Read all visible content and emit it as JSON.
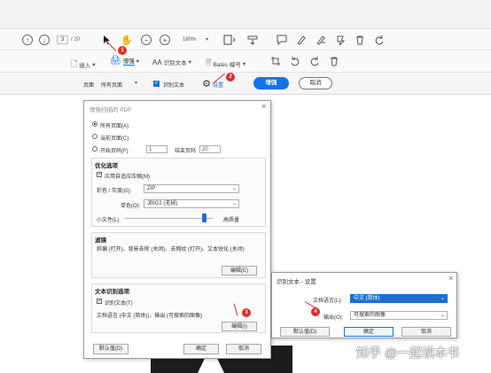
{
  "toolbar1": {
    "page_current": "3",
    "page_total": "/ 20",
    "zoom": "160%"
  },
  "toolbar2": {
    "insert_label": "插入",
    "enhance_label": "增强",
    "ocr_text_label": "识别文本",
    "bates_label": "Bates 编号"
  },
  "toolbar3": {
    "pages_label": "页面",
    "pages_value": "所有页面",
    "ocr_checkbox_label": "识别文本",
    "settings_label": "设置",
    "enhance_button": "增强",
    "cancel_button": "取消"
  },
  "badges": [
    "1",
    "2",
    "3",
    "4"
  ],
  "dialog_main": {
    "title": "增强扫描的 PDF",
    "all_pages": "所有页面(A)",
    "current_page": "当前页面(C)",
    "from_page": "开始页码(F)",
    "from_value": "1",
    "to_label": "结束页码",
    "to_value": "20",
    "optimize_head": "优化选项",
    "adaptive": "应用自适应压缩(M)",
    "color_label": "彩色 / 灰度(G):",
    "color_value": "ZIP",
    "mono_label": "单色(O):",
    "mono_value": "JBIG2 (无损)",
    "small_label": "小文件(L)",
    "high_label": "高质量",
    "filter_head": "滤镜",
    "filter_desc": "斜偏 (打开)、背景去除 (关闭)、去网纹 (打开)、文本锐化 (关闭)",
    "edit_button_1": "编辑(E)",
    "ocr_head": "文本识别选项",
    "ocr_check": "识别文本(T)",
    "ocr_desc": "文档语言 (中文 (简体))，输出 (可搜索的图像)",
    "edit_button_2": "编辑(I)",
    "default_button": "默认值(D)",
    "ok_button": "确定",
    "cancel_button": "取消"
  },
  "dialog_ocr": {
    "title": "识别文本 - 设置",
    "lang_label": "文档语言(L):",
    "lang_value": "中文 (简体)",
    "output_label": "输出(O):",
    "output_value": "可搜索的图像",
    "default_button": "默认值(D)",
    "ok_button": "确定",
    "cancel_button": "取消"
  },
  "watermark": "知乎 @一起读本书",
  "colors": {
    "accent": "#1473e6",
    "badge_red": "#e22b2b",
    "selection": "#1a6fd8"
  }
}
